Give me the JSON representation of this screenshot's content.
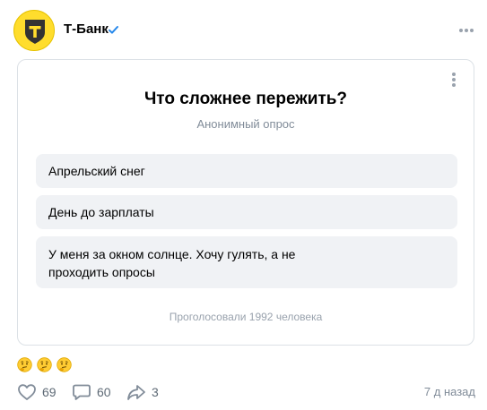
{
  "post": {
    "author": "Т-Банк",
    "timestamp": "7 д назад"
  },
  "poll": {
    "title": "Что сложнее пережить?",
    "subtitle": "Анонимный опрос",
    "options": [
      "Апрельский снег",
      "День до зарплаты",
      "У меня за окном солнце. Хочу гулять, а не проходить опросы"
    ],
    "votes_text": "Проголосовали 1992 человека"
  },
  "reactions": {
    "emojis": [
      "thinking-face-icon",
      "thinking-face-icon",
      "thinking-face-icon"
    ]
  },
  "actions": {
    "likes": "69",
    "comments": "60",
    "shares": "3"
  },
  "colors": {
    "brand": "#ffdd2d",
    "accent": "#2688eb",
    "muted": "#818c99",
    "option_bg": "#f0f2f5"
  }
}
